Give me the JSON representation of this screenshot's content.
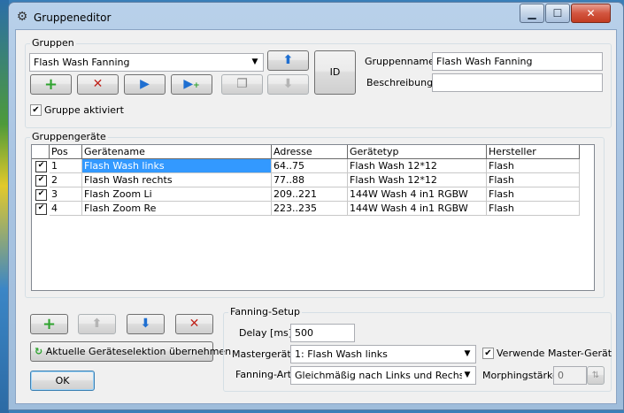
{
  "window": {
    "title": "Gruppeneditor",
    "min_symbol": "▁",
    "max_symbol": "☐",
    "close_symbol": "✕"
  },
  "gruppen": {
    "label": "Gruppen",
    "selected_group": "Flash Wash Fanning",
    "id_button": "ID",
    "name_label": "Gruppenname:",
    "name_value": "Flash Wash Fanning",
    "description_label": "Beschreibung:",
    "description_value": "",
    "activated_label": "Gruppe aktiviert",
    "activated": true,
    "toolbar_icons": {
      "add": "+",
      "delete": "✕",
      "play": "▶",
      "play_add": "▶",
      "copy": "❐",
      "down": "⬇",
      "up": "⬆"
    }
  },
  "geraete": {
    "label": "Gruppengeräte",
    "columns": [
      "Pos",
      "Gerätename",
      "Adresse",
      "Gerätetyp",
      "Hersteller"
    ],
    "rows": [
      {
        "checked": true,
        "pos": "1",
        "name": "Flash Wash links",
        "adresse": "64..75",
        "typ": "Flash Wash 12*12",
        "hersteller": "Flash",
        "selected": true
      },
      {
        "checked": true,
        "pos": "2",
        "name": "Flash Wash rechts",
        "adresse": "77..88",
        "typ": "Flash Wash 12*12",
        "hersteller": "Flash",
        "selected": false
      },
      {
        "checked": true,
        "pos": "3",
        "name": "Flash Zoom Li",
        "adresse": "209..221",
        "typ": "144W Wash 4 in1 RGBW",
        "hersteller": "Flash",
        "selected": false
      },
      {
        "checked": true,
        "pos": "4",
        "name": "Flash Zoom Re",
        "adresse": "223..235",
        "typ": "144W Wash 4 in1 RGBW",
        "hersteller": "Flash",
        "selected": false
      }
    ]
  },
  "bottom": {
    "icons": {
      "add": "+",
      "up": "⬆",
      "down": "⬇",
      "delete": "✕"
    },
    "take_selection_label": "Aktuelle Geräteselektion übernehmen",
    "ok_label": "OK"
  },
  "fanning": {
    "label": "Fanning-Setup",
    "delay_label": "Delay [ms]:",
    "delay_value": "500",
    "master_label": "Mastergerät:",
    "master_value": "1: Flash Wash links",
    "use_master_label": "Verwende Master-Gerät",
    "use_master": true,
    "art_label": "Fanning-Art:",
    "art_value": "Gleichmäßig nach Links und Rechs",
    "morph_label": "Morphingstärke:",
    "morph_value": "0"
  },
  "colors": {
    "green": "#2fa32f",
    "red": "#c0241c",
    "blue": "#1f6fd1",
    "selection": "#3399ff"
  }
}
